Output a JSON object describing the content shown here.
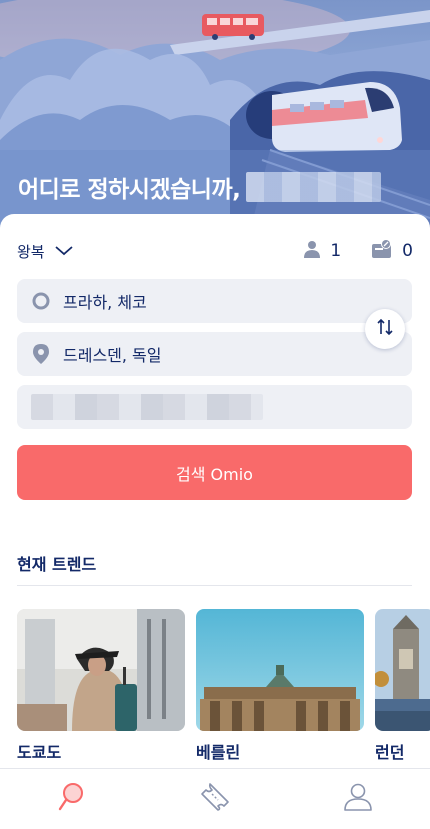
{
  "hero": {
    "title": "어디로 정하시겠습니까,"
  },
  "search_form": {
    "trip_type": "왕복",
    "passengers_count": "1",
    "discount_cards_count": "0",
    "origin": "프라하, 체코",
    "destination": "드레스덴, 독일",
    "search_button_label": "검색 Omio"
  },
  "trends": {
    "title": "현재 트렌드",
    "cards": [
      {
        "label": "도쿄도"
      },
      {
        "label": "베를린"
      },
      {
        "label": "런던"
      }
    ]
  },
  "colors": {
    "brand_navy": "#132968",
    "accent_red": "#f96a6a",
    "field_bg": "#eef0f5"
  },
  "bottom_nav": {
    "items": [
      {
        "icon": "search-icon",
        "active": true
      },
      {
        "icon": "ticket-icon",
        "active": false
      },
      {
        "icon": "profile-icon",
        "active": false
      }
    ]
  }
}
